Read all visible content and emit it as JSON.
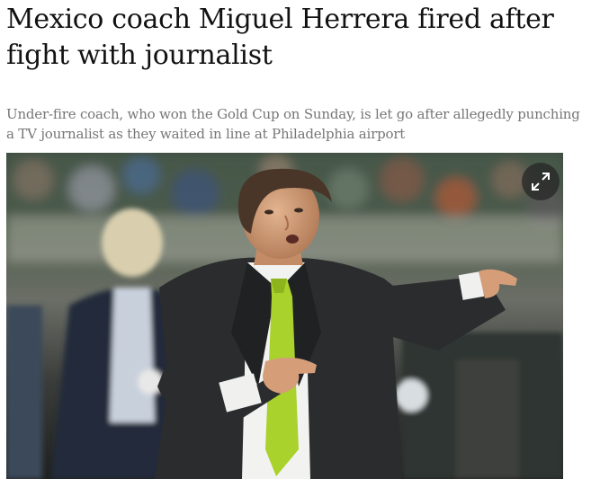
{
  "article": {
    "headline": "Mexico coach Miguel Herrera fired after fight with journalist",
    "standfirst": "Under-fire coach, who won the Gold Cup on Sunday, is let go after allegedly punching a TV journalist as they waited in line at Philadelphia airport"
  },
  "media": {
    "expand_icon": "expand-icon"
  },
  "colors": {
    "headline": "#121212",
    "standfirst": "#767676",
    "tie": "#a9d22c",
    "suit": "#2a2c2e"
  }
}
